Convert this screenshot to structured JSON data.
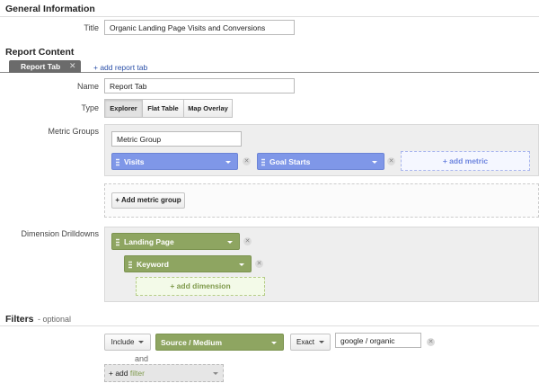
{
  "general": {
    "heading": "General Information",
    "title_label": "Title",
    "title_value": "Organic Landing Page Visits and Conversions"
  },
  "report": {
    "heading": "Report Content",
    "tab_label": "Report Tab",
    "add_tab_link": "+ add report tab",
    "name_label": "Name",
    "name_value": "Report Tab",
    "type_label": "Type",
    "types": [
      "Explorer",
      "Flat Table",
      "Map Overlay"
    ],
    "selected_type": "Explorer"
  },
  "metrics": {
    "label": "Metric Groups",
    "group_name": "Metric Group",
    "items": [
      "Visits",
      "Goal Starts"
    ],
    "add_metric": "+ add metric",
    "add_group_button": "+ Add metric group"
  },
  "dimensions": {
    "label": "Dimension Drilldowns",
    "items": [
      "Landing Page",
      "Keyword"
    ],
    "add_dimension": "+ add dimension"
  },
  "filters": {
    "heading": "Filters",
    "optional": "- optional",
    "include": "Include",
    "dimension": "Source / Medium",
    "match": "Exact",
    "value": "google / organic",
    "and": "and",
    "add_prefix": "+ add",
    "add_word": "filter"
  },
  "colors": {
    "metric_blue": "#7f97e8",
    "dimension_green": "#8ea561",
    "link_blue": "#2a4fa8"
  }
}
